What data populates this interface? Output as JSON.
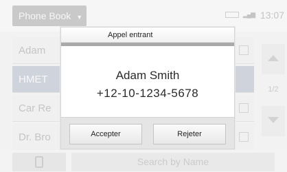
{
  "background": {
    "app_title": "Phone Book",
    "status_time": "13:07",
    "contacts": [
      {
        "label": "Adam",
        "selected": false
      },
      {
        "label": "HMET",
        "selected": true
      },
      {
        "label": "Car Re",
        "selected": false
      },
      {
        "label": "Dr. Bro",
        "selected": false
      }
    ],
    "page_indicator": "1/2",
    "search_placeholder": "Search by Name"
  },
  "dialog": {
    "title": "Appel entrant",
    "caller_name": "Adam Smith",
    "caller_number": "+12-10-1234-5678",
    "accept_label": "Accepter",
    "reject_label": "Rejeter"
  }
}
